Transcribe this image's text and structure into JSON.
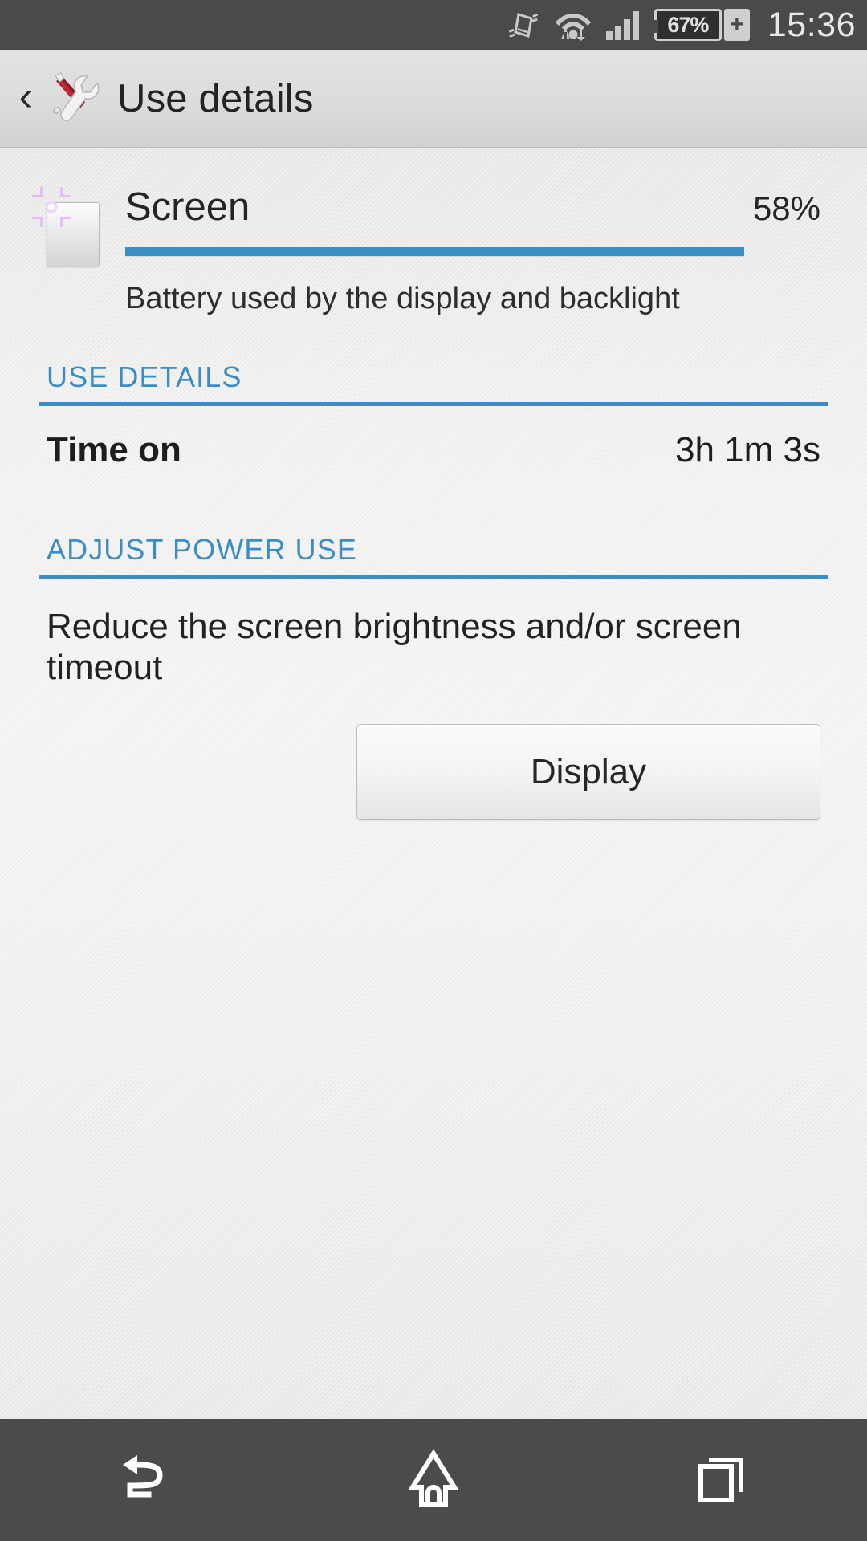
{
  "statusbar": {
    "clock": "15:36",
    "battery_percent": "67%",
    "battery_plus": "+",
    "icons": [
      "vibrate-icon",
      "wifi-data-icon",
      "signal-bars-icon",
      "battery-icon"
    ]
  },
  "titlebar": {
    "back_label": "‹",
    "app_icon": "tools-icon",
    "title": "Use details"
  },
  "summary": {
    "icon": "screen-icon",
    "name": "Screen",
    "percent": "58%",
    "progress_value": 89,
    "description": "Battery used by the display and backlight"
  },
  "sections": {
    "use_details": {
      "header": "USE DETAILS",
      "rows": [
        {
          "key": "Time on",
          "value": "3h 1m 3s"
        }
      ]
    },
    "adjust_power_use": {
      "header": "ADJUST POWER USE",
      "body": "Reduce the screen brightness and/or screen timeout",
      "button_label": "Display"
    }
  },
  "navbar": {
    "back": "back-icon",
    "home": "home-icon",
    "recents": "recents-icon"
  },
  "colors": {
    "accent_blue": "#3d8dc4",
    "status_bg": "#4a4a4a",
    "nav_bg": "#4b4b4b",
    "title_text": "#232323"
  }
}
